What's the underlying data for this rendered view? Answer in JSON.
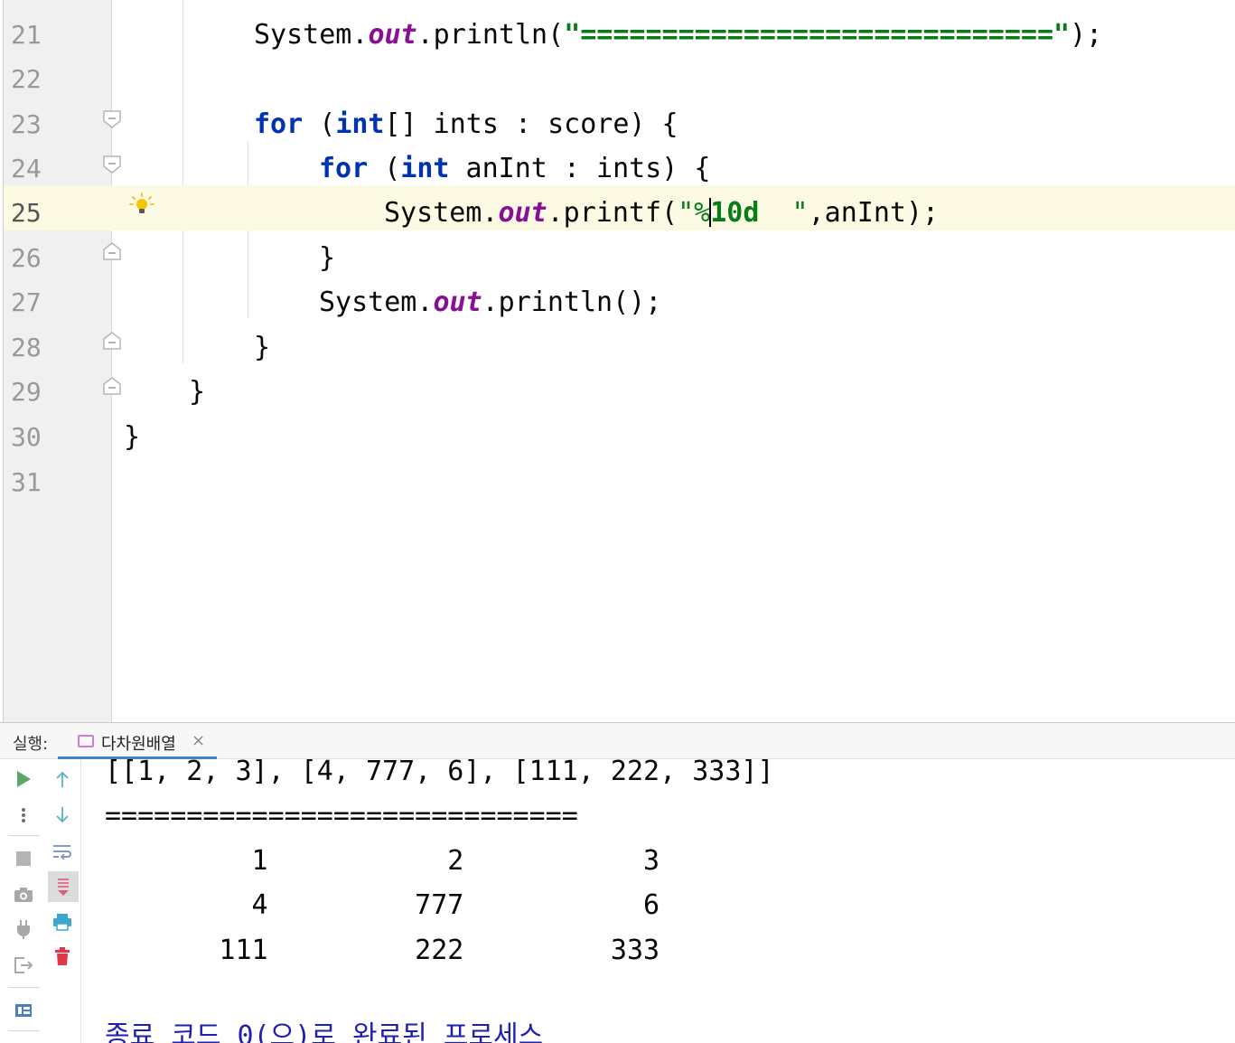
{
  "editor": {
    "lines": [
      {
        "num": "21"
      },
      {
        "num": "22"
      },
      {
        "num": "23"
      },
      {
        "num": "24"
      },
      {
        "num": "25"
      },
      {
        "num": "26"
      },
      {
        "num": "27"
      },
      {
        "num": "28"
      },
      {
        "num": "29"
      },
      {
        "num": "30"
      },
      {
        "num": "31"
      }
    ],
    "code": {
      "l21": {
        "a": "System.",
        "b": "out",
        "c": ".println(",
        "d": "\"=============================\"",
        "e": ");"
      },
      "l23": {
        "kw1": "for",
        "p1": " (",
        "kw2": "int",
        "rest": "[] ints : score) {"
      },
      "l24": {
        "kw1": "for",
        "p1": " (",
        "kw2": "int",
        "rest": " anInt : ints) {"
      },
      "l25": {
        "a": "System.",
        "b": "out",
        "c": ".printf(",
        "d1": "\"%",
        "d2": "10d",
        "d3": "  \"",
        "e": ",anInt);"
      },
      "l26": {
        "a": "}"
      },
      "l27": {
        "a": "System.",
        "b": "out",
        "c": ".println();"
      },
      "l28": {
        "a": "}"
      },
      "l29": {
        "a": "}"
      },
      "l30": {
        "a": "}"
      }
    },
    "current_line": "25"
  },
  "run_panel": {
    "label": "실행:",
    "tab_name": "다차원배열",
    "tab_close": "×",
    "output": [
      "[[1, 2, 3], [4, 777, 6], [111, 222, 333]]",
      "=============================",
      "         1           2           3",
      "         4         777           6",
      "       111         222         333",
      "",
      "종료 코드 0(으)로 완료된 프로세스"
    ]
  },
  "colors": {
    "keyword": "#0033b3",
    "field": "#871094",
    "string": "#067d17",
    "current_line_bg": "#fdfae3",
    "exit_text": "#1f1fb0"
  },
  "icons": {
    "toolbar_col1": [
      "run-icon",
      "more-icon",
      "stop-icon",
      "camera-icon",
      "plug-icon",
      "exit-icon",
      "layout-icon"
    ],
    "toolbar_col2": [
      "up-arrow-icon",
      "down-arrow-icon",
      "soft-wrap-icon",
      "scroll-to-end-icon",
      "print-icon",
      "trash-icon"
    ],
    "gutter": [
      "lightbulb-icon",
      "fold-icon"
    ]
  }
}
